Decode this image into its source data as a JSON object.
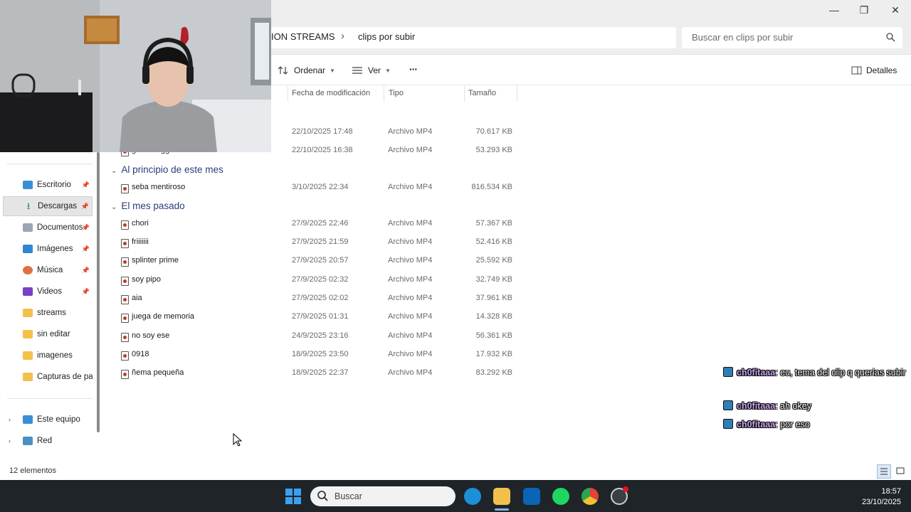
{
  "window": {
    "minimize_glyph": "—",
    "restore_glyph": "❐",
    "close_glyph": "✕"
  },
  "address": {
    "crumbs": [
      "ION STREAMS",
      "clips por subir"
    ],
    "separator": "›"
  },
  "search": {
    "placeholder": "Buscar en clips por subir"
  },
  "toolbar": {
    "sort_label": "Ordenar",
    "view_label": "Ver",
    "more_label": "···",
    "details_label": "Detalles"
  },
  "columns": {
    "date": "Fecha de modificación",
    "type": "Tipo",
    "size": "Tamaño"
  },
  "sidebar": {
    "items": [
      {
        "label": "Escritorio",
        "icon": "desktop-icon",
        "pinned": true
      },
      {
        "label": "Descargas",
        "icon": "download-icon",
        "pinned": true,
        "selected": true
      },
      {
        "label": "Documentos",
        "icon": "documents-icon",
        "pinned": true
      },
      {
        "label": "Imágenes",
        "icon": "pictures-icon",
        "pinned": true
      },
      {
        "label": "Música",
        "icon": "music-icon",
        "pinned": true
      },
      {
        "label": "Videos",
        "icon": "videos-icon",
        "pinned": true
      },
      {
        "label": "streams",
        "icon": "folder-icon",
        "pinned": false
      },
      {
        "label": "sin editar",
        "icon": "folder-icon",
        "pinned": false
      },
      {
        "label": "imagenes",
        "icon": "folder-icon",
        "pinned": false
      },
      {
        "label": "Capturas de par",
        "icon": "folder-icon",
        "pinned": false
      }
    ],
    "bottom": [
      {
        "label": "Este equipo",
        "icon": "computer-icon"
      },
      {
        "label": "Red",
        "icon": "network-icon"
      }
    ],
    "pin_glyph": "📌"
  },
  "groups": {
    "this_month": "Al principio de este mes",
    "last_month": "El mes pasado"
  },
  "files": {
    "recent": [
      {
        "name": "",
        "date": "22/10/2025 17:48",
        "type": "Archivo MP4",
        "size": "70.617 KB"
      },
      {
        "name": "gorda reggae",
        "date": "22/10/2025 16:38",
        "type": "Archivo MP4",
        "size": "53.293 KB"
      }
    ],
    "this_month": [
      {
        "name": "seba mentiroso",
        "date": "3/10/2025 22:34",
        "type": "Archivo MP4",
        "size": "816.534 KB"
      }
    ],
    "last_month": [
      {
        "name": "chori",
        "date": "27/9/2025 22:46",
        "type": "Archivo MP4",
        "size": "57.367 KB"
      },
      {
        "name": "friiiiiii",
        "date": "27/9/2025 21:59",
        "type": "Archivo MP4",
        "size": "52.416 KB"
      },
      {
        "name": "splinter prime",
        "date": "27/9/2025 20:57",
        "type": "Archivo MP4",
        "size": "25.592 KB"
      },
      {
        "name": "soy pipo",
        "date": "27/9/2025 02:32",
        "type": "Archivo MP4",
        "size": "32.749 KB"
      },
      {
        "name": "aia",
        "date": "27/9/2025 02:02",
        "type": "Archivo MP4",
        "size": "37.961 KB"
      },
      {
        "name": "juega de memoria",
        "date": "27/9/2025 01:31",
        "type": "Archivo MP4",
        "size": "14.328 KB"
      },
      {
        "name": "no soy ese",
        "date": "24/9/2025 23:16",
        "type": "Archivo MP4",
        "size": "56.361 KB"
      },
      {
        "name": "0918",
        "date": "18/9/2025 23:50",
        "type": "Archivo MP4",
        "size": "17.932 KB"
      },
      {
        "name": "ñema pequeña",
        "date": "18/9/2025 22:37",
        "type": "Archivo MP4",
        "size": "83.292 KB"
      }
    ]
  },
  "status": {
    "count": "12 elementos"
  },
  "chat": [
    {
      "user": "ch0fitaaa",
      "text": ": eu, tema del clip q querias subir"
    },
    {
      "user": "ch0fitaaa",
      "text": ": ah okey"
    },
    {
      "user": "ch0fitaaa",
      "text": ": por eso"
    }
  ],
  "taskbar": {
    "search_placeholder": "Buscar",
    "time": "18:57",
    "date": "23/10/2025"
  },
  "colors": {
    "accent": "#0067c0",
    "group_header": "#2a3d7a",
    "taskbar": "#1f2428",
    "chat_user": "#c9a6f0"
  }
}
